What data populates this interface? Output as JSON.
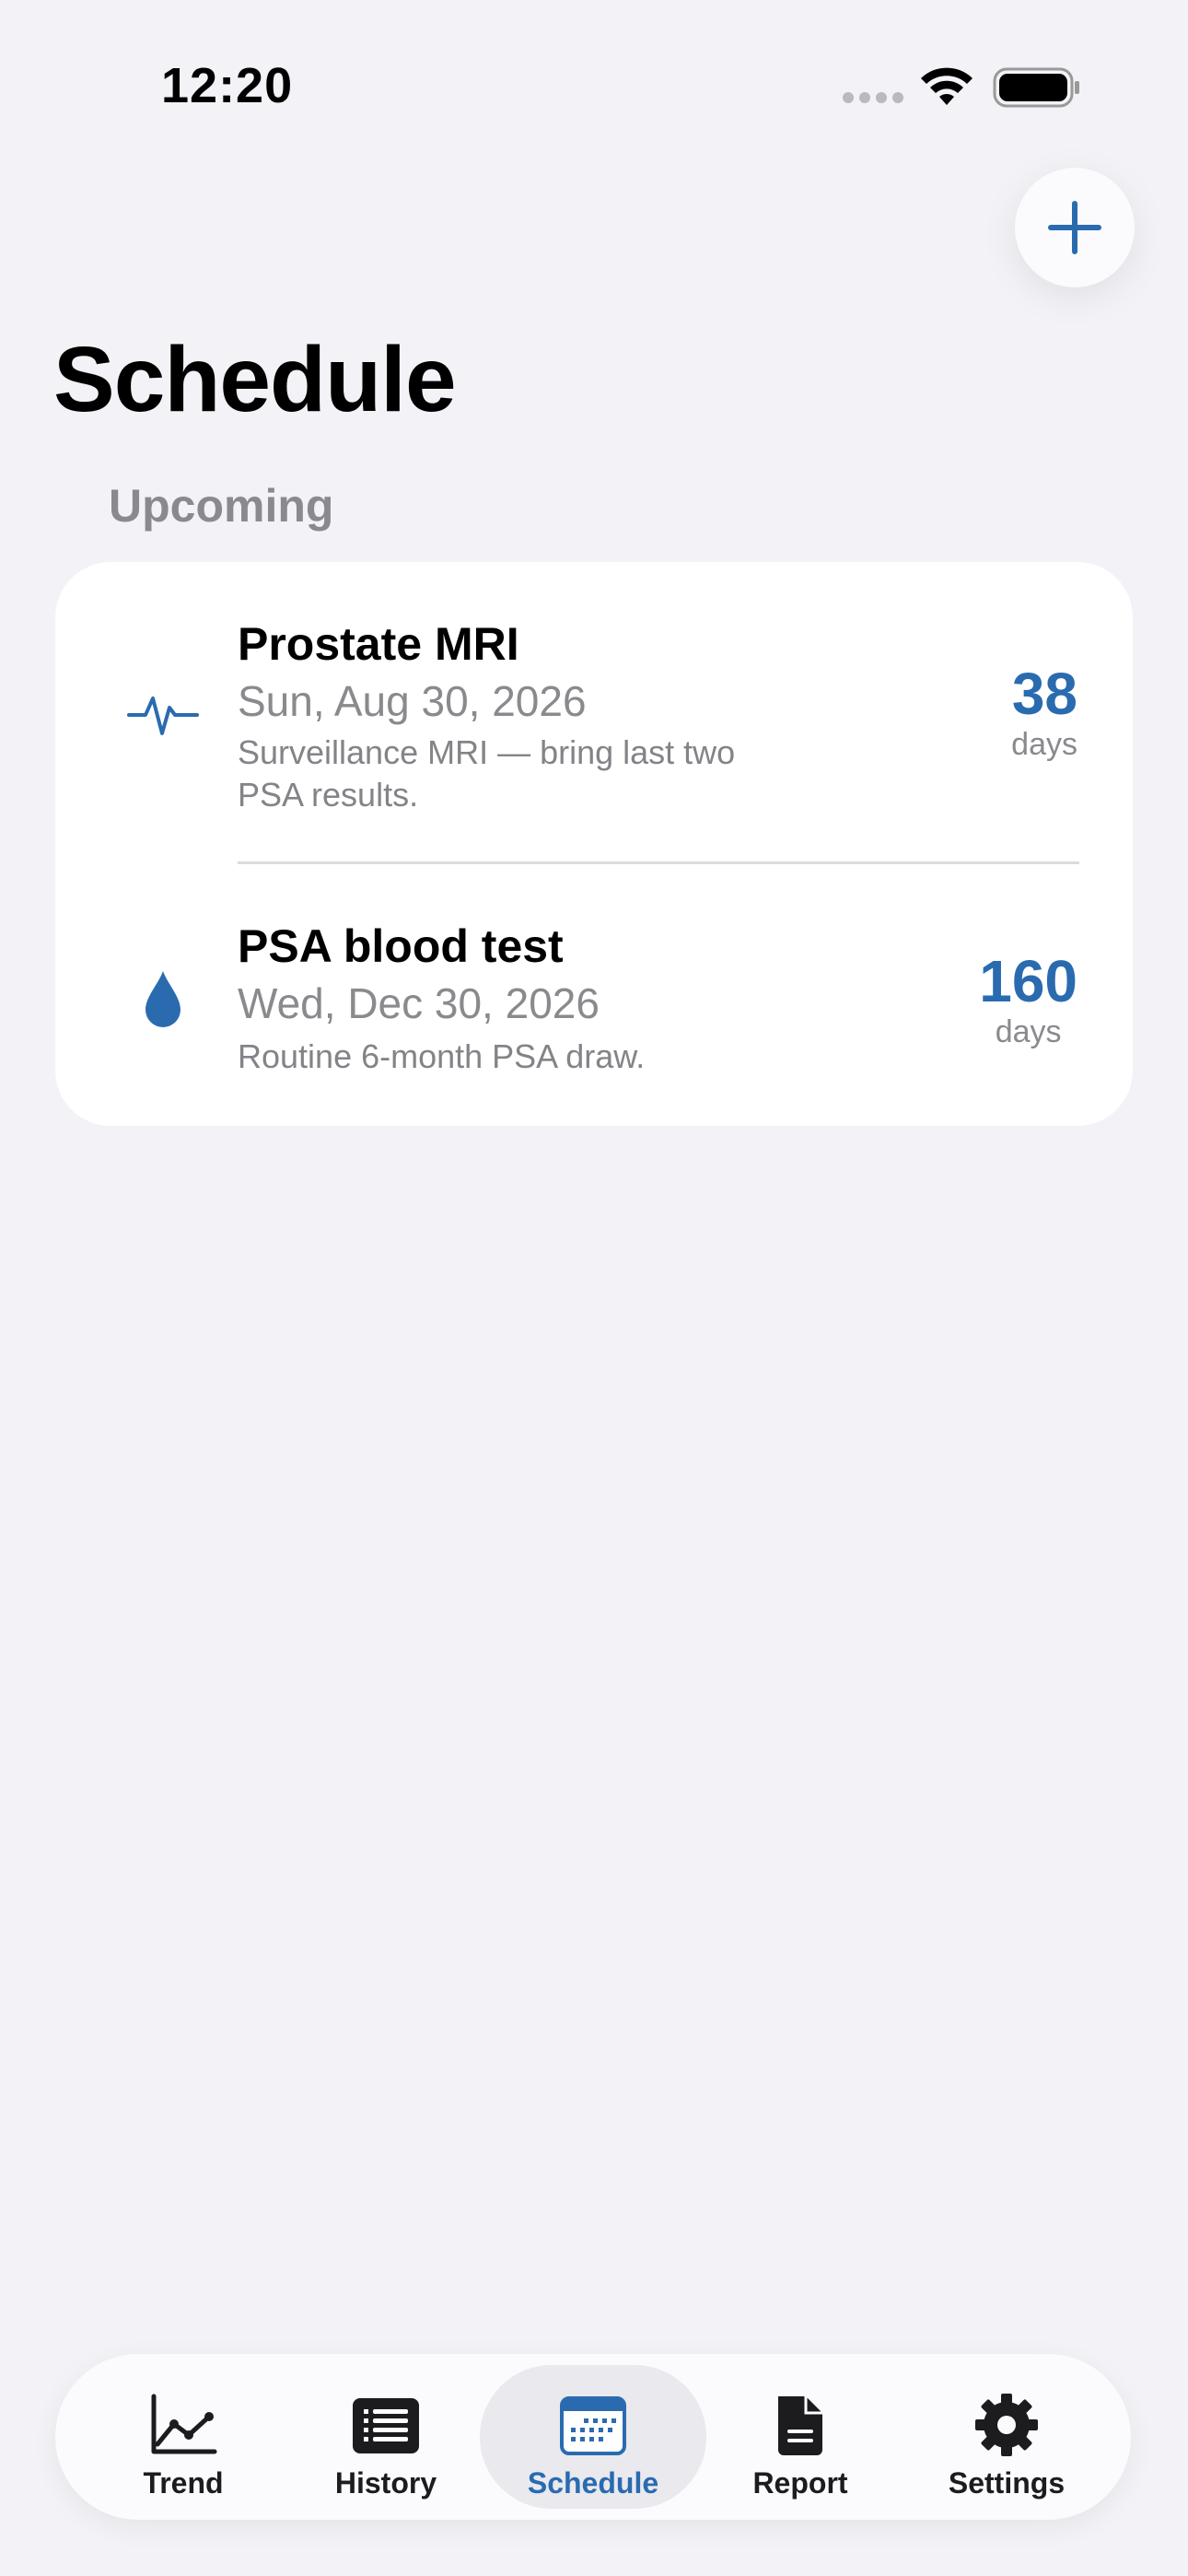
{
  "status_bar": {
    "time": "12:20"
  },
  "header": {
    "title": "Schedule"
  },
  "section": {
    "label": "Upcoming"
  },
  "appointments": [
    {
      "icon": "waveform-icon",
      "title": "Prostate MRI",
      "date": "Sun, Aug 30, 2026",
      "note": "Surveillance MRI — bring last two PSA results.",
      "days_value": "38",
      "days_unit": "days"
    },
    {
      "icon": "drop-icon",
      "title": "PSA blood test",
      "date": "Wed, Dec 30, 2026",
      "note": "Routine 6-month PSA draw.",
      "days_value": "160",
      "days_unit": "days"
    }
  ],
  "tabs": [
    {
      "label": "Trend",
      "icon": "chart-line-icon",
      "active": false
    },
    {
      "label": "History",
      "icon": "list-icon",
      "active": false
    },
    {
      "label": "Schedule",
      "icon": "calendar-icon",
      "active": true
    },
    {
      "label": "Report",
      "icon": "document-icon",
      "active": false
    },
    {
      "label": "Settings",
      "icon": "gear-icon",
      "active": false
    }
  ],
  "colors": {
    "accent": "#2a6bb0",
    "background": "#f2f2f7",
    "card": "#ffffff",
    "secondary_text": "#8a8a8e"
  }
}
